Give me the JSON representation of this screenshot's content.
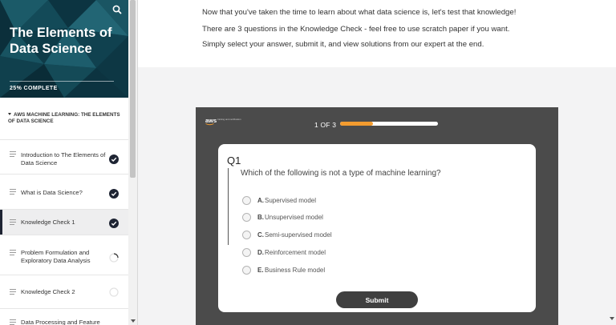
{
  "course": {
    "title": "The Elements of Data Science",
    "progress_text": "25% COMPLETE",
    "section_heading": "AWS MACHINE LEARNING: THE ELEMENTS OF DATA SCIENCE"
  },
  "icons": {
    "search": "search-icon",
    "lesson": "lines-icon",
    "complete": "check-circle-icon",
    "in_progress": "partial-circle-icon",
    "not_started": "empty-circle-icon"
  },
  "lessons": [
    {
      "label": "Introduction to The Elements of Data Science",
      "status": "complete"
    },
    {
      "label": "What is Data Science?",
      "status": "complete"
    },
    {
      "label": "Knowledge Check 1",
      "status": "complete"
    },
    {
      "label": "Problem Formulation and Exploratory Data Analysis",
      "status": "in-progress"
    },
    {
      "label": "Knowledge Check 2",
      "status": "not-started"
    },
    {
      "label": "Data Processing and Feature",
      "status": "not-started"
    }
  ],
  "intro": {
    "line1": "Now that you've taken the time to learn about what data science is, let's test that knowledge!",
    "line2": "There are 3 questions in the Knowledge Check - feel free to use scratch paper if you want.",
    "line3": "Simply select your answer, submit it, and view solutions from our expert at the end."
  },
  "quiz": {
    "logo": {
      "word": "aws",
      "subtitle": "training and certification"
    },
    "counter": "1 OF 3",
    "progress_fraction": 0.333,
    "question_number": "Q1",
    "question": "Which of the following is not a type of machine learning?",
    "options": [
      {
        "letter": "A.",
        "text": "Supervised model"
      },
      {
        "letter": "B.",
        "text": "Unsupervised model"
      },
      {
        "letter": "C.",
        "text": "Semi-supervised model"
      },
      {
        "letter": "D.",
        "text": "Reinforcement model"
      },
      {
        "letter": "E.",
        "text": "Business Rule model"
      }
    ],
    "submit_label": "Submit"
  },
  "colors": {
    "hero_bg": "#0f3d4b",
    "progress_accent": "#f39c2f",
    "quiz_bg": "#4b4b4b",
    "status_dark": "#1e2433"
  }
}
